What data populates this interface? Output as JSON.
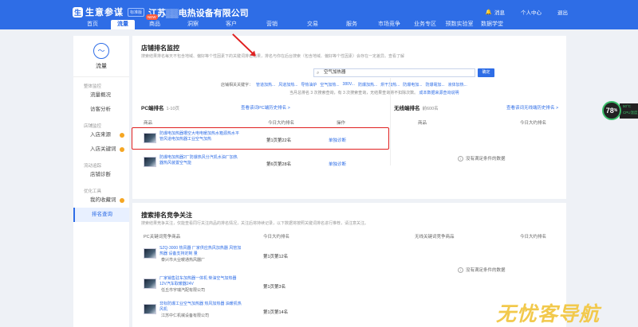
{
  "header": {
    "logo_glyph": "生",
    "app_title": "生意参谋",
    "app_tag": "标准版",
    "shop_name": "江苏▒▒电热设备有限公司",
    "messages": "消息",
    "personal_center": "个人中心",
    "logout": "退出",
    "nav": [
      {
        "label": "首页"
      },
      {
        "label": "流量",
        "active": true
      },
      {
        "label": "商品",
        "badge": "NEW"
      },
      {
        "label": "洞察"
      },
      {
        "label": "客户"
      },
      {
        "label": "营销"
      },
      {
        "label": "交易"
      },
      {
        "label": "服务"
      },
      {
        "label": "市场竞争"
      },
      {
        "label": "业务专区"
      },
      {
        "label": "预数实验室"
      },
      {
        "label": "数据学堂"
      }
    ]
  },
  "sidebar": {
    "title": "流量",
    "groups": [
      {
        "label": "整体监控",
        "items": [
          {
            "label": "流量概况"
          },
          {
            "label": "访客分析"
          }
        ]
      },
      {
        "label": "店铺监控",
        "items": [
          {
            "label": "入店来源",
            "dot": true
          },
          {
            "label": "入店关键词",
            "dot": true
          }
        ]
      },
      {
        "label": "流动追踪",
        "items": [
          {
            "label": "店铺诊断"
          }
        ]
      },
      {
        "label": "优化工具",
        "items": [
          {
            "label": "我的收藏词",
            "dot": true
          },
          {
            "label": "排名查询",
            "active": true
          }
        ]
      }
    ]
  },
  "monitor": {
    "title": "店铺排名监控",
    "desc": "搜索结果排名每天不包含地域、偏好等个性因素下的关键词排名结果，排名与你在后台搜索（包含地域、偏好等个性因素）会存在一定差异。查看了解",
    "search_value": "空气加热器",
    "search_button": "确定",
    "suggest_label": "店铺相关关键字：",
    "suggestions": [
      "管道加热...",
      "风道加热...",
      "导热油炉",
      "空气加热...",
      "380V...",
      "防爆加热...",
      "烘干加热...",
      "防爆电加...",
      "防爆電加...",
      "液体加热..."
    ],
    "hint_text": "当月总排名 3 次搜索查询，有 3 次搜索查询，无结果查询将不扣除次数。",
    "hint_link": "成本数据来源查询说明",
    "pc": {
      "label": "PC端排名",
      "range": "1-10页",
      "link": "查看该词PC端历史排名 >",
      "col_product": "商品",
      "col_rank": "今日大约排名",
      "col_op": "操作",
      "rows": [
        {
          "title": "防爆电加热器槽空大电电暖加热水箱源热水平管风道电加热器工业空气加热",
          "rank": "第1页第22名",
          "op": "单独诊断"
        },
        {
          "title": "防爆电加热器2厂防爆热风分汽机水油厂加热器热风装置空气能",
          "rank": "第6页第28名",
          "op": "单独诊断"
        }
      ]
    },
    "wireless": {
      "label": "无线端排名",
      "range": "前600名",
      "link": "查看该词无线端历史排名 >",
      "col_product": "商品",
      "col_rank": "今日大约排名",
      "empty": "没有满足条件的数据"
    }
  },
  "competition": {
    "title": "搜索排名竞争关注",
    "desc": "搜索结果竞争关注，仅能查看同行关注商品的排名情况，关注后将持续记录，以下数据将按照关键词排名进行推荐，请注意关注。",
    "pc_col": "PC关键词竞争商品",
    "rank_col": "今日大约排名",
    "wireless_col": "无线关键词竞争商品",
    "wireless_rank_col": "今日大约排名",
    "empty": "没有满足条件的数据",
    "rows": [
      {
        "title": "SZQ-3000 热风器 厂家供应热风加热器 风管加热器 设备支持定制 量",
        "shop": "泰兴市大业暖通热风器厂",
        "rank": "第1页第12名"
      },
      {
        "title": "厂家销售驻车加热器一体机 柴油空气加热器12V汽车取暖器24V",
        "shop": "任丘市宇瑞汽配有限公司",
        "rank": "第1页第3名"
      },
      {
        "title": "非标防爆工业空气加热器 热风加热器 油暖机热风机",
        "shop": "江苏中仁机械设备有限公司",
        "rank": "第1页第14名"
      }
    ]
  },
  "widget": {
    "percent": "78",
    "unit": "%",
    "temp": "50°C",
    "cpu": "CPU温度"
  },
  "watermark": "无忧客导航"
}
